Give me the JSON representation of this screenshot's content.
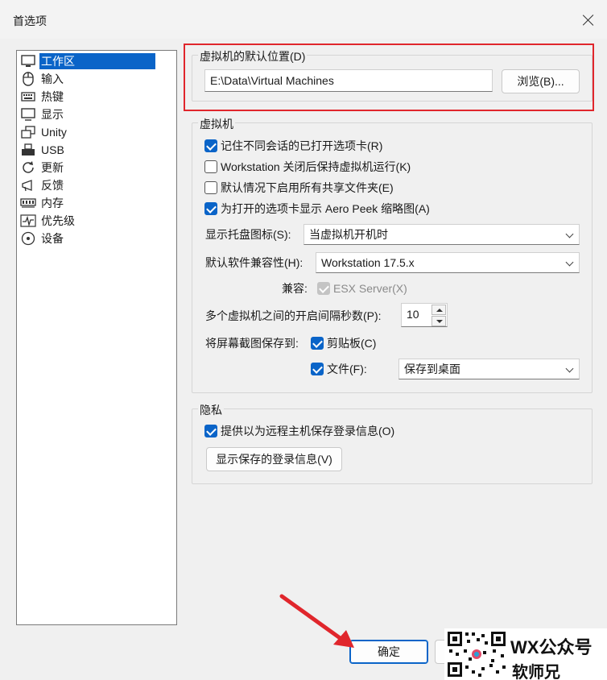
{
  "window": {
    "title": "首选项"
  },
  "tree": {
    "items": [
      {
        "label": "工作区",
        "icon": "workspace-icon",
        "selected": true
      },
      {
        "label": "输入",
        "icon": "mouse-icon"
      },
      {
        "label": "热键",
        "icon": "keyboard-icon"
      },
      {
        "label": "显示",
        "icon": "monitor-icon"
      },
      {
        "label": "Unity",
        "icon": "unity-icon"
      },
      {
        "label": "USB",
        "icon": "usb-icon"
      },
      {
        "label": "更新",
        "icon": "refresh-icon"
      },
      {
        "label": "反馈",
        "icon": "megaphone-icon"
      },
      {
        "label": "内存",
        "icon": "memory-icon"
      },
      {
        "label": "优先级",
        "icon": "pulse-icon"
      },
      {
        "label": "设备",
        "icon": "disc-icon"
      }
    ]
  },
  "default_location": {
    "group_label": "虚拟机的默认位置(D)",
    "path": "E:\\Data\\Virtual Machines",
    "browse_label": "浏览(B)..."
  },
  "vm": {
    "group_label": "虚拟机",
    "remember_tabs": {
      "label": "记住不同会话的已打开选项卡(R)",
      "checked": true
    },
    "keep_running": {
      "label": "Workstation 关闭后保持虚拟机运行(K)",
      "checked": false
    },
    "enable_shared": {
      "label": "默认情况下启用所有共享文件夹(E)",
      "checked": false
    },
    "aero_peek": {
      "label": "为打开的选项卡显示 Aero Peek 缩略图(A)",
      "checked": true
    },
    "tray_icon": {
      "label": "显示托盘图标(S):",
      "value": "当虚拟机开机时"
    },
    "compat": {
      "label": "默认软件兼容性(H):",
      "value": "Workstation 17.5.x"
    },
    "compat_with": {
      "label": "兼容:",
      "option": "ESX Server(X)",
      "checked": true,
      "disabled": true
    },
    "delay": {
      "label": "多个虚拟机之间的开启间隔秒数(P):",
      "value": "10"
    },
    "screenshot": {
      "label": "将屏幕截图保存到:",
      "clipboard": {
        "label": "剪贴板(C)",
        "checked": true
      },
      "file": {
        "label": "文件(F):",
        "checked": true,
        "value": "保存到桌面"
      }
    }
  },
  "privacy": {
    "group_label": "隐私",
    "remember_login": {
      "label": "提供以为远程主机保存登录信息(O)",
      "checked": true
    },
    "show_saved_label": "显示保存的登录信息(V)"
  },
  "footer": {
    "ok_label": "确定"
  },
  "watermark": {
    "line1": "WX公众号",
    "line2": "软师兄"
  },
  "colors": {
    "accent": "#0a64c8",
    "highlight": "#e0262c"
  }
}
